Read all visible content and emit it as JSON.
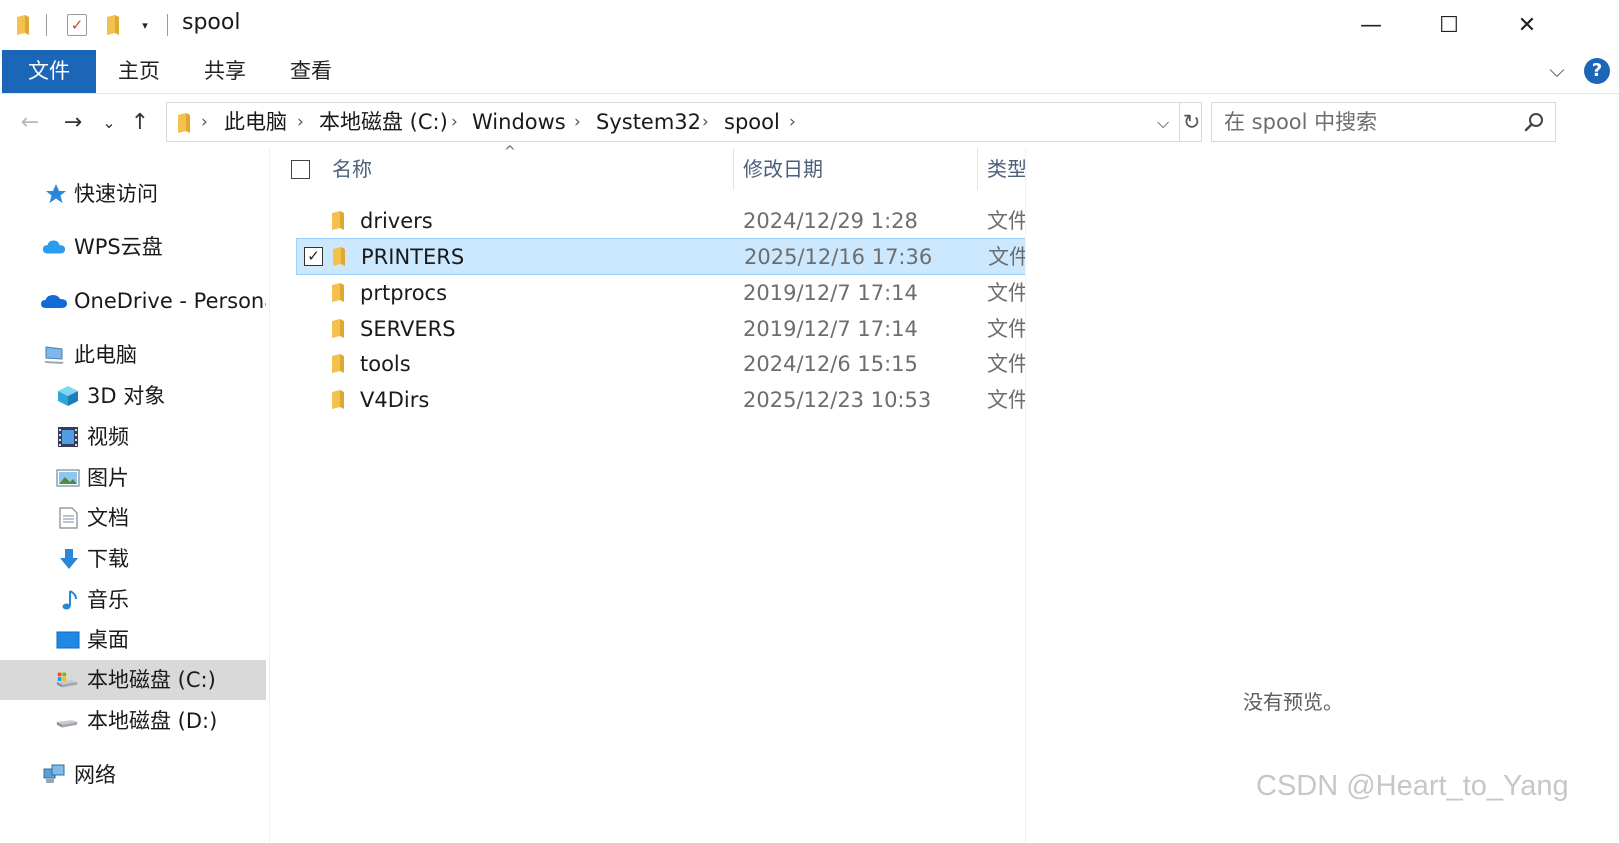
{
  "window": {
    "title": "spool",
    "minimize_glyph": "—",
    "maximize_glyph": "☐",
    "close_glyph": "✕"
  },
  "quick_access_toolbar": {
    "properties_glyph": "✓",
    "customize_glyph": "▾"
  },
  "ribbon": {
    "tabs": [
      {
        "label": "文件",
        "active": true
      },
      {
        "label": "主页"
      },
      {
        "label": "共享"
      },
      {
        "label": "查看"
      }
    ],
    "expand_glyph": "⌵",
    "help_glyph": "?"
  },
  "navigation": {
    "back_glyph": "←",
    "forward_glyph": "→",
    "recent_glyph": "⌄",
    "up_glyph": "↑"
  },
  "address_bar": {
    "breadcrumbs": [
      "此电脑",
      "本地磁盘 (C:)",
      "Windows",
      "System32",
      "spool"
    ],
    "separator": "›",
    "dropdown_glyph": "⌵",
    "refresh_glyph": "↻"
  },
  "search": {
    "placeholder": "在 spool 中搜索"
  },
  "nav_pane": {
    "items": [
      {
        "label": "快速访问",
        "icon": "star-icon"
      },
      {
        "label": "WPS云盘",
        "icon": "cloud-icon"
      },
      {
        "label": "OneDrive - Persona",
        "icon": "onedrive-icon"
      },
      {
        "label": "此电脑",
        "icon": "computer-icon"
      },
      {
        "label": "3D 对象",
        "icon": "cube-icon"
      },
      {
        "label": "视频",
        "icon": "video-icon"
      },
      {
        "label": "图片",
        "icon": "picture-icon"
      },
      {
        "label": "文档",
        "icon": "document-icon"
      },
      {
        "label": "下载",
        "icon": "download-icon"
      },
      {
        "label": "音乐",
        "icon": "music-icon"
      },
      {
        "label": "桌面",
        "icon": "desktop-icon"
      },
      {
        "label": "本地磁盘 (C:)",
        "icon": "system-drive-icon",
        "selected": true
      },
      {
        "label": "本地磁盘 (D:)",
        "icon": "drive-icon"
      },
      {
        "label": "网络",
        "icon": "network-icon"
      }
    ]
  },
  "file_list": {
    "columns": {
      "name": "名称",
      "date": "修改日期",
      "type": "类型"
    },
    "sort_glyph": "^",
    "check_glyph": "✓",
    "rows": [
      {
        "name": "drivers",
        "date": "2024/12/29 1:28",
        "type": "文件",
        "selected": false
      },
      {
        "name": "PRINTERS",
        "date": "2025/12/16 17:36",
        "type": "文件",
        "selected": true
      },
      {
        "name": "prtprocs",
        "date": "2019/12/7 17:14",
        "type": "文件",
        "selected": false
      },
      {
        "name": "SERVERS",
        "date": "2019/12/7 17:14",
        "type": "文件",
        "selected": false
      },
      {
        "name": "tools",
        "date": "2024/12/6 15:15",
        "type": "文件",
        "selected": false
      },
      {
        "name": "V4Dirs",
        "date": "2025/12/23 10:53",
        "type": "文件",
        "selected": false
      }
    ]
  },
  "preview_pane": {
    "message": "没有预览。"
  },
  "watermark": "CSDN @Heart_to_Yang",
  "colors": {
    "accent": "#1c66b8",
    "selection_bg": "#cce8ff",
    "selection_border": "#99d1ff",
    "folder": "#f2c14e",
    "nav_selected": "#d9d9d9"
  }
}
